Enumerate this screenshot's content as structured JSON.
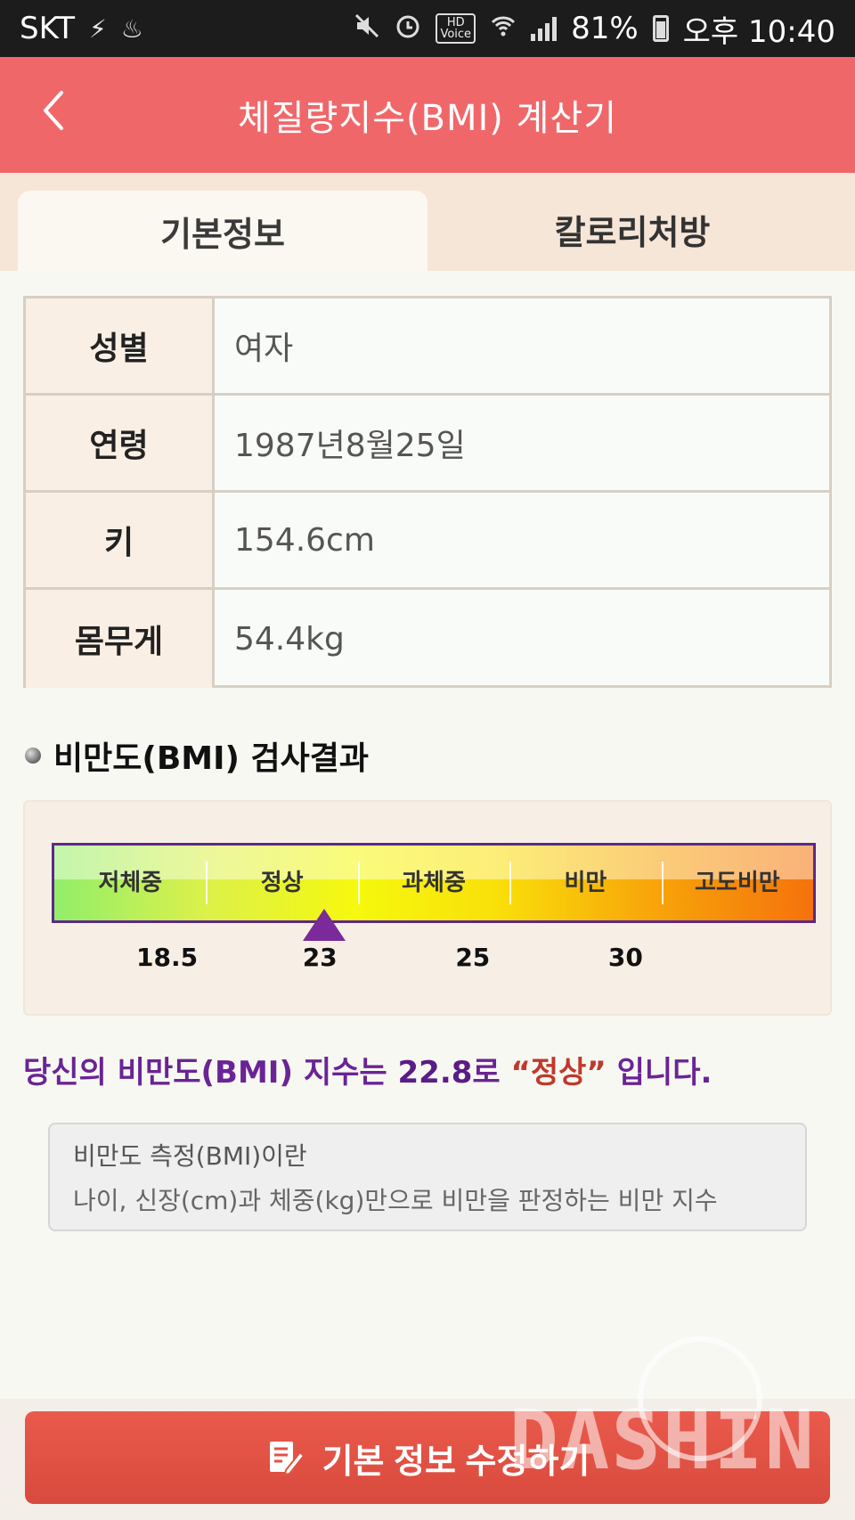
{
  "status_bar": {
    "carrier": "SKT",
    "battery": "81%",
    "time": "오후 10:40",
    "hd_label": "HD",
    "voice_label": "Voice"
  },
  "header": {
    "title": "체질량지수(BMI) 계산기"
  },
  "tabs": [
    {
      "label": "기본정보",
      "active": true
    },
    {
      "label": "칼로리처방",
      "active": false
    }
  ],
  "info": {
    "rows": [
      {
        "label": "성별",
        "value": "여자"
      },
      {
        "label": "연령",
        "value": "1987년8월25일"
      },
      {
        "label": "키",
        "value": "154.6cm"
      },
      {
        "label": "몸무게",
        "value": "54.4kg"
      }
    ]
  },
  "bmi_section": {
    "title": "비만도(BMI) 검사결과",
    "categories": [
      "저체중",
      "정상",
      "과체중",
      "비만",
      "고도비만"
    ],
    "thresholds": [
      "18.5",
      "23",
      "25",
      "30"
    ],
    "bmi_value": 22.8
  },
  "result": {
    "prefix": "당신의 비만도(BMI) 지수는 ",
    "value": "22.8",
    "middle": "로 ",
    "category": "“정상”",
    "suffix": " 입니다."
  },
  "explanation": {
    "title": "비만도 측정(BMI)이란",
    "description": "나이, 신장(cm)과 체중(kg)만으로 비만을 판정하는 비만 지수"
  },
  "watermark": "DASHIN",
  "bottom_button": {
    "label": "기본 정보 수정하기"
  },
  "colors": {
    "header": "#f0676a",
    "tab_bar": "#f6e6d8",
    "result_text": "#6a2495",
    "result_category": "#c0392b",
    "button": "#e15244"
  }
}
